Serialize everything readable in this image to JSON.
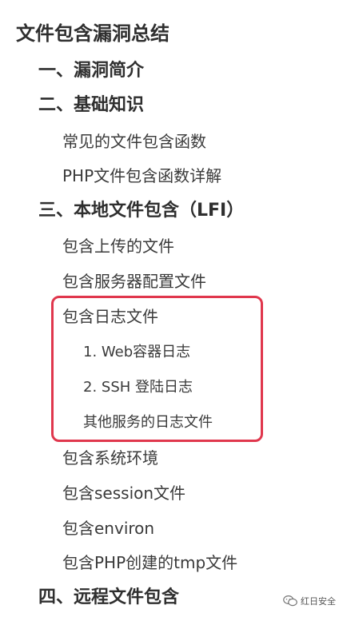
{
  "toc": {
    "title": "文件包含漏洞总结",
    "s1": "一、漏洞简介",
    "s2": "二、基础知识",
    "s2_a": "常见的文件包含函数",
    "s2_b": "PHP文件包含函数详解",
    "s3": "三、本地文件包含（LFI）",
    "s3_a": "包含上传的文件",
    "s3_b": "包含服务器配置文件",
    "s3_c": "包含日志文件",
    "s3_c1": "1. Web容器日志",
    "s3_c2": "2. SSH 登陆日志",
    "s3_c3": "其他服务的日志文件",
    "s3_d": "包含系统环境",
    "s3_e": "包含session文件",
    "s3_f": "包含environ",
    "s3_g": "包含PHP创建的tmp文件",
    "s4": "四、远程文件包含"
  },
  "watermark": {
    "text": "红日安全",
    "icon": "wechat-icon"
  },
  "colors": {
    "highlight": "#e0374d",
    "text": "#333333"
  }
}
